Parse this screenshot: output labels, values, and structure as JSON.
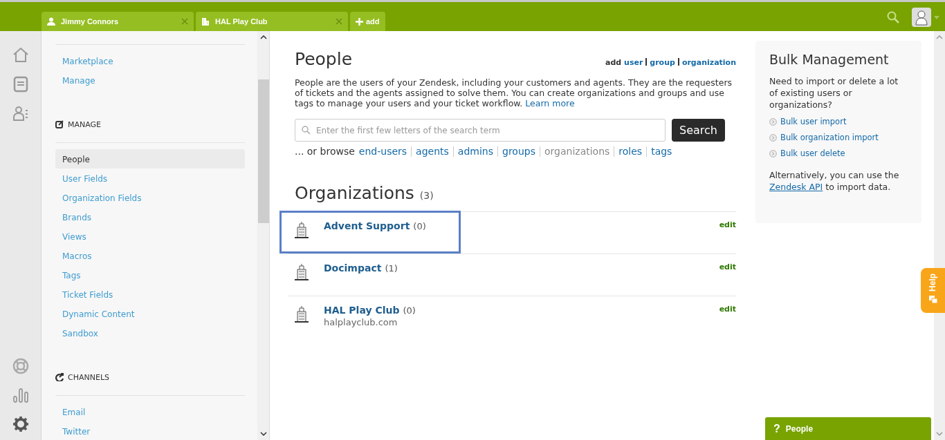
{
  "tabs": [
    {
      "kind": "user",
      "label": "Jimmy Connors",
      "selected": false
    },
    {
      "kind": "organization",
      "label": "HAL Play Club",
      "selected": false
    }
  ],
  "add_tab": {
    "label": "add"
  },
  "rail": [
    {
      "kind": "home"
    },
    {
      "kind": "views"
    },
    {
      "kind": "customers"
    },
    {
      "kind": "spacer"
    },
    {
      "kind": "help"
    },
    {
      "kind": "reporting"
    },
    {
      "kind": "admin",
      "selected": true
    }
  ],
  "sidebar": {
    "sections": [
      {
        "kind": "none",
        "items": [
          {
            "label": "Marketplace",
            "selected": false
          },
          {
            "label": "Manage",
            "selected": false
          }
        ]
      },
      {
        "kind": "manage",
        "heading": "MANAGE",
        "items": [
          {
            "label": "People",
            "selected": true
          },
          {
            "label": "User Fields",
            "selected": false
          },
          {
            "label": "Organization Fields",
            "selected": false
          },
          {
            "label": "Brands",
            "selected": false
          },
          {
            "label": "Views",
            "selected": false
          },
          {
            "label": "Macros",
            "selected": false
          },
          {
            "label": "Tags",
            "selected": false
          },
          {
            "label": "Ticket Fields",
            "selected": false
          },
          {
            "label": "Dynamic Content",
            "selected": false
          },
          {
            "label": "Sandbox",
            "selected": false
          }
        ]
      },
      {
        "kind": "channels",
        "heading": "CHANNELS",
        "items": [
          {
            "label": "Email",
            "selected": false
          },
          {
            "label": "Twitter",
            "selected": false
          }
        ]
      }
    ]
  },
  "page": {
    "title": "People",
    "add_links": {
      "label": "add",
      "links": [
        "user",
        "group",
        "organization"
      ]
    },
    "description": "People are the users of your Zendesk, including your customers and agents. They are the requesters of tickets and the agents assigned to solve them. You can create organizations and groups and use tags to manage your users and your ticket workflow.",
    "learn_more": "Learn more",
    "search": {
      "placeholder": "Enter the first few letters of the search term",
      "button": "Search"
    },
    "browse": {
      "label": "... or browse",
      "links": [
        {
          "label": "end-users",
          "selected": false
        },
        {
          "label": "agents",
          "selected": false
        },
        {
          "label": "admins",
          "selected": false
        },
        {
          "label": "groups",
          "selected": false
        },
        {
          "label": "organizations",
          "selected": true
        },
        {
          "label": "roles",
          "selected": false
        },
        {
          "label": "tags",
          "selected": false
        }
      ]
    },
    "organizations": {
      "title": "Organizations",
      "count": "(3)",
      "rows": [
        {
          "name": "Advent Support",
          "count": "(0)",
          "edit": "edit",
          "highlighted": true
        },
        {
          "name": "Docimpact",
          "count": "(1)",
          "edit": "edit",
          "highlighted": false
        },
        {
          "name": "HAL Play Club",
          "count": "(0)",
          "domain": "halplayclub.com",
          "edit": "edit",
          "highlighted": false
        }
      ]
    }
  },
  "bulk": {
    "title": "Bulk Management",
    "intro": "Need to import or delete a lot of existing users or organizations?",
    "links": [
      "Bulk user import",
      "Bulk organization import",
      "Bulk user delete"
    ],
    "outro_before": "Alternatively, you can use the",
    "api_link": "Zendesk API",
    "outro_after": "to import data."
  },
  "help_tab": {
    "label": "Help"
  },
  "help_bar": {
    "icon": "?",
    "label": "People"
  }
}
